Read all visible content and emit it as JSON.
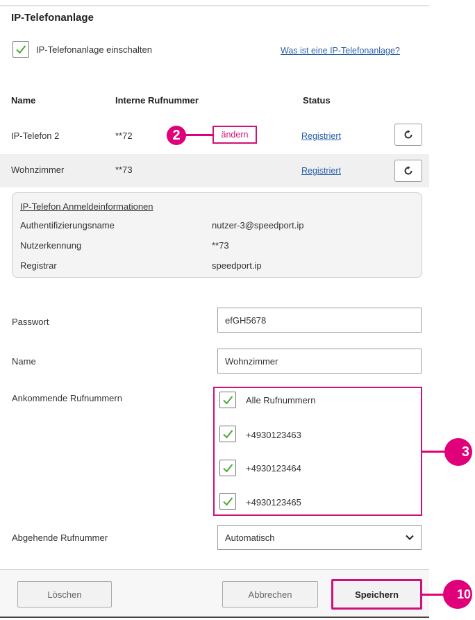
{
  "title": "IP-Telefonanlage",
  "enable": {
    "label": "IP-Telefonanlage einschalten",
    "checked": true
  },
  "help_link": "Was ist eine IP-Telefonanlage?",
  "table": {
    "headers": {
      "name": "Name",
      "number": "Interne Rufnummer",
      "status": "Status"
    },
    "rows": [
      {
        "name": "IP-Telefon 2",
        "number": "**72",
        "edit": "ändern",
        "status": "Registriert"
      },
      {
        "name": "Wohnzimmer",
        "number": "**73",
        "status": "Registriert"
      }
    ]
  },
  "login_info": {
    "title": "IP-Telefon Anmeldeinformationen",
    "rows": [
      {
        "label": "Authentifizierungsname",
        "value": "nutzer-3@speedport.ip"
      },
      {
        "label": "Nutzerkennung",
        "value": "**73"
      },
      {
        "label": "Registrar",
        "value": "speedport.ip"
      }
    ]
  },
  "form": {
    "password": {
      "label": "Passwort",
      "value": "efGH5678"
    },
    "name": {
      "label": "Name",
      "value": "Wohnzimmer"
    },
    "incoming": {
      "label": "Ankommende Rufnummern",
      "options": [
        "Alle Rufnummern",
        "+4930123463",
        "+4930123464",
        "+4930123465"
      ]
    },
    "outgoing": {
      "label": "Abgehende Rufnummer",
      "value": "Automatisch"
    }
  },
  "buttons": {
    "delete": "Löschen",
    "cancel": "Abbrechen",
    "save": "Speichern"
  },
  "markers": {
    "m2": "2",
    "m3": "3",
    "m10": "10"
  },
  "colors": {
    "accent": "#e0007a",
    "link": "#2a5fa8",
    "check": "#4aa832"
  }
}
